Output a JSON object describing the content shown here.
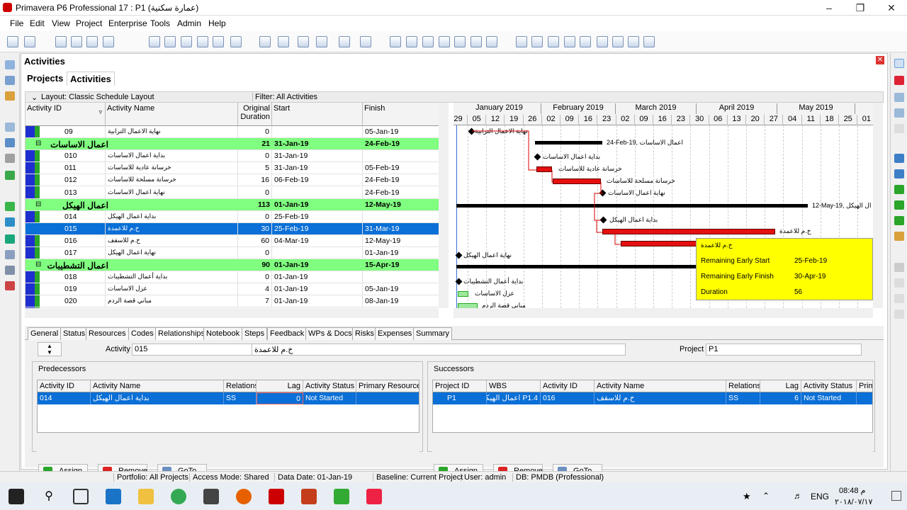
{
  "window": {
    "title": "Primavera P6 Professional 17 : P1 (عمارة سكنية)"
  },
  "menu": [
    "File",
    "Edit",
    "View",
    "Project",
    "Enterprise",
    "Tools",
    "Admin",
    "Help"
  ],
  "panel": {
    "title": "Activities",
    "tabs": [
      "Projects",
      "Activities"
    ]
  },
  "layout": {
    "label": "Layout: Classic Schedule Layout",
    "filter": "Filter: All Activities"
  },
  "grid": {
    "headers": [
      "Activity ID",
      "Activity Name",
      "Original Duration",
      "Start",
      "Finish"
    ],
    "rows": [
      {
        "id": "09",
        "name": "نهاية الاعمال الترابية",
        "dur": "0",
        "start": "",
        "finish": "05-Jan-19",
        "type": "act"
      },
      {
        "id": "",
        "name": "اعمال الاساسات",
        "dur": "21",
        "start": "31-Jan-19",
        "finish": "24-Feb-19",
        "type": "wbs"
      },
      {
        "id": "010",
        "name": "بداية اعمال الاساسات",
        "dur": "0",
        "start": "31-Jan-19",
        "finish": "",
        "type": "act"
      },
      {
        "id": "011",
        "name": "خرسانة عادية للاساسات",
        "dur": "5",
        "start": "31-Jan-19",
        "finish": "05-Feb-19",
        "type": "act"
      },
      {
        "id": "012",
        "name": "خرسانة مسلحة للاساسات",
        "dur": "16",
        "start": "06-Feb-19",
        "finish": "24-Feb-19",
        "type": "act"
      },
      {
        "id": "013",
        "name": "نهاية اعمال الاساسات",
        "dur": "0",
        "start": "",
        "finish": "24-Feb-19",
        "type": "act"
      },
      {
        "id": "",
        "name": "اعمال الهيكل",
        "dur": "113",
        "start": "01-Jan-19",
        "finish": "12-May-19",
        "type": "wbs"
      },
      {
        "id": "014",
        "name": "بداية اعمال الهيكل",
        "dur": "0",
        "start": "25-Feb-19",
        "finish": "",
        "type": "act"
      },
      {
        "id": "015",
        "name": "خ.م للاعمدة",
        "dur": "30",
        "start": "25-Feb-19",
        "finish": "31-Mar-19",
        "type": "sel"
      },
      {
        "id": "016",
        "name": "خ.م للاسقف",
        "dur": "60",
        "start": "04-Mar-19",
        "finish": "12-May-19",
        "type": "act"
      },
      {
        "id": "017",
        "name": "نهاية اعمال الهيكل",
        "dur": "0",
        "start": "",
        "finish": "01-Jan-19",
        "type": "act"
      },
      {
        "id": "",
        "name": "اعمال التشطيبات",
        "dur": "90",
        "start": "01-Jan-19",
        "finish": "15-Apr-19",
        "type": "wbs"
      },
      {
        "id": "018",
        "name": "بداية أعمال التشطيبات",
        "dur": "0",
        "start": "01-Jan-19",
        "finish": "",
        "type": "act"
      },
      {
        "id": "019",
        "name": "عزل الاساسات",
        "dur": "4",
        "start": "01-Jan-19",
        "finish": "05-Jan-19",
        "type": "act"
      },
      {
        "id": "020",
        "name": "مباني قصة الردم",
        "dur": "7",
        "start": "01-Jan-19",
        "finish": "08-Jan-19",
        "type": "act"
      }
    ]
  },
  "gantt": {
    "months": [
      "January 2019",
      "February 2019",
      "March 2019",
      "April 2019",
      "May 2019"
    ],
    "weeks": [
      "29",
      "05",
      "12",
      "19",
      "26",
      "02",
      "09",
      "16",
      "23",
      "02",
      "09",
      "16",
      "23",
      "30",
      "06",
      "13",
      "20",
      "27",
      "04",
      "11",
      "18",
      "25",
      "01"
    ],
    "labels": {
      "l0": "نهاية الاعمال الترابية",
      "l1": "24-Feb-19, اعمال الاساسات",
      "l2": "بداية اعمال الاساسات",
      "l3": "خرسانة عادية للاساسات",
      "l4": "خرسانة مسلحة للاساسات",
      "l5": "نهاية اعمال الاساسات",
      "l6": "12-May-19, ال الهيكل",
      "l7": "بداية اعمال الهيكل",
      "l8": "خ.م للاعمدة",
      "l10": "نهاية اعمال الهيكل",
      "l12": "بداية أعمال التشطيبات",
      "l13": "عزل الاساسات",
      "l14": "مباني قصة الردم"
    },
    "tooltip": {
      "name": "خ.م للاعمدة",
      "rows": [
        {
          "k": "Remaining Early Start",
          "v": "25-Feb-19"
        },
        {
          "k": "Remaining Early Finish",
          "v": "30-Apr-19"
        },
        {
          "k": "Duration",
          "v": "56"
        }
      ]
    }
  },
  "bottom_tabs": [
    "General",
    "Status",
    "Resources",
    "Codes",
    "Relationships",
    "Notebook",
    "Steps",
    "Feedback",
    "WPs & Docs",
    "Risks",
    "Expenses",
    "Summary"
  ],
  "detail": {
    "activity_label": "Activity",
    "activity_id": "015",
    "activity_name": "خ.م للاعمدة",
    "project_label": "Project",
    "project": "P1",
    "predecessors": {
      "title": "Predecessors",
      "headers": [
        "Activity ID",
        "Activity Name",
        "Relations",
        "Lag",
        "Activity Status",
        "Primary Resource"
      ],
      "row": [
        "014",
        "بداية اعمال الهيكل",
        "SS",
        "0",
        "Not Started",
        ""
      ]
    },
    "successors": {
      "title": "Successors",
      "headers": [
        "Project ID",
        "WBS",
        "Activity ID",
        "Activity Name",
        "Relations",
        "Lag",
        "Activity Status",
        "Primary"
      ],
      "row": [
        "P1",
        "P1.4 اعمال الهيكل",
        "016",
        "خ.م للاسقف",
        "SS",
        "6",
        "Not Started",
        ""
      ]
    },
    "buttons": [
      "Assign",
      "Remove",
      "GoTo"
    ]
  },
  "status": [
    "Portfolio: All Projects",
    "Access Mode: Shared",
    "Data Date: 01-Jan-19",
    "Baseline: Current Project",
    "User: admin",
    "DB: PMDB (Professional)"
  ],
  "tray": {
    "lang": "ENG",
    "time": "08:48 م",
    "date": "٢٠١٨/٠٧/١٧"
  }
}
